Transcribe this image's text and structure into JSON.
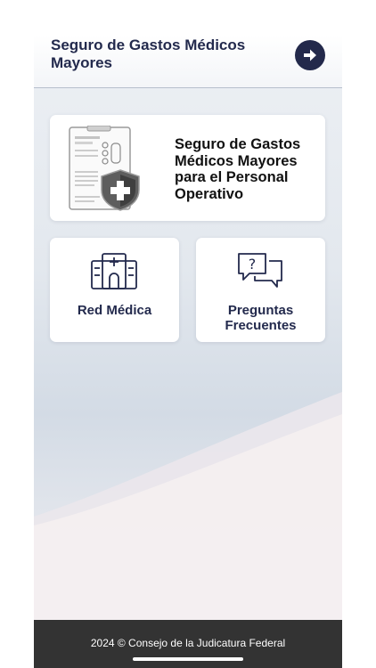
{
  "header": {
    "title": "Seguro de Gastos Médicos Mayores",
    "next_icon": "arrow-right-icon"
  },
  "cards": {
    "main": {
      "label": "Seguro de Gastos Médicos Mayores para el Personal Operativo",
      "icon": "insurance-document-shield-icon"
    },
    "red_medica": {
      "label": "Red Médica",
      "icon": "hospital-icon"
    },
    "preguntas": {
      "label": "Preguntas Frecuentes",
      "icon": "chat-question-icon"
    }
  },
  "footer": {
    "text": "2024 © Consejo de la Judicatura Federal"
  },
  "colors": {
    "navy": "#232a4d",
    "footer_bg": "#333333",
    "card_bg": "#ffffff"
  }
}
